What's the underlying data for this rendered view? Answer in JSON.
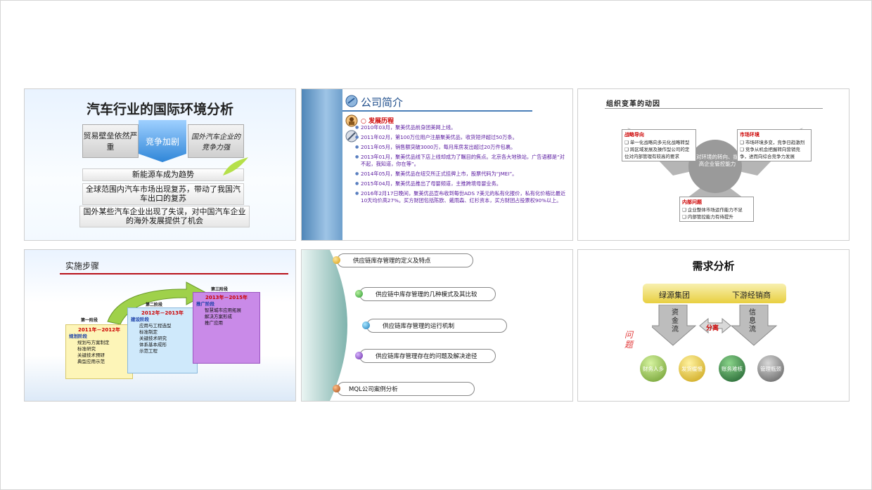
{
  "slides": [
    {
      "title": "汽车行业的国际环境分析",
      "box_left": "贸易壁垒依然严重",
      "box_center": "竞争加剧",
      "box_right": "国外汽车企业的竞争力强",
      "points": [
        "新能源车成为趋势",
        "全球范围内汽车市场出现复苏，带动了我国汽车出口的复苏",
        "国外某些汽车企业出现了失误，对中国汽车企业的海外发展提供了机会"
      ]
    },
    {
      "title": "公司简介",
      "section": "发展历程",
      "items": [
        "2010年03月，聚美优品前身团美网上线。",
        "2011年02月，第100万位用户注册聚美优品，收货短评超过50万条。",
        "2011年05月，销售额突破3000万，每月库房发出超过20万件包裹。",
        "2013年01月，聚美优品线下店上线却成为了瞩目的焦点。北京各大地铁站，广告语都是“对不起，我知道，你在等”。",
        "2014年05月，聚美优品在纽交所正式挂牌上市，股票代码为“JMEI”。",
        "2015年04月，聚美优品推出了母婴频道，主推跨境母婴业务。",
        "2016年2月17日晚间，聚美优品宣布收到每份ADS 7美元的私有化报价，私有化价格比最近10天均价高27%。买方财团包括陈欧、戴雨森、红杉资本，买方财团占投票权90%以上。"
      ]
    },
    {
      "title": "组织变革的动因",
      "center": "对环境的转向、提高企业管控能力",
      "left": {
        "title": "战略导向",
        "items": [
          "❑ 单一化战略向多元化战略转型",
          "❑ 跨区域发展及操作型公司的定位对内部管理有较高的要求"
        ]
      },
      "right": {
        "title": "市场环境",
        "items": [
          "❑ 市场环境多变，竞争日趋激烈",
          "❑ 竞争从机会把握转向营销竞争，进而向综合竞争力发展"
        ]
      },
      "bottom": {
        "title": "内部问题",
        "items": [
          "❑ 企业整体市场运作能力不足",
          "❑ 内部管控能力有待提升"
        ]
      }
    },
    {
      "title": "实施步骤",
      "phases": [
        {
          "stage": "第一阶段",
          "years": "2011年－2012年",
          "name": "规划阶段",
          "tasks": [
            "规划与方案制定",
            "标准研究",
            "关键技术预研",
            "典型应用示范"
          ]
        },
        {
          "stage": "第二阶段",
          "years": "2012年－2013年",
          "name": "建设阶段",
          "tasks": [
            "应用与工程选型",
            "标准制定",
            "关键技术研究",
            "体系基本成形",
            "示范工程"
          ]
        },
        {
          "stage": "第三阶段",
          "years": "2013年－2015年",
          "name": "推广阶段",
          "tasks": [
            "智慧城市应用拓展",
            "解决方案形成",
            "推广应用"
          ]
        }
      ]
    },
    {
      "items": [
        "供应链库存管理的定义及特点",
        "供应链中库存管理的几种模式及其比较",
        "供应链库存管理的运行机制",
        "供应链库存管理存在的问题及解决途径",
        "MQL公司案例分析"
      ]
    },
    {
      "title": "需求分析",
      "left_label": "绿源集团",
      "right_label": "下游经销商",
      "flow_left": "资金流",
      "flow_right": "信息流",
      "middle": "分离",
      "side_label": "问题",
      "problems": [
        "财务人多",
        "发货缓慢",
        "账务难核",
        "管理瓶颈"
      ]
    }
  ]
}
